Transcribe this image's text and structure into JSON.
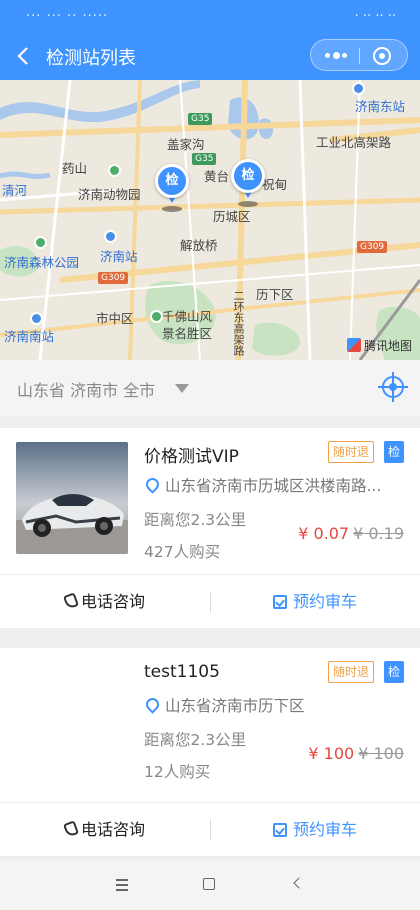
{
  "status_bar": {
    "left_text": "··· ··· ·· ·····",
    "right_text": "· ·· ·· ··"
  },
  "header": {
    "title": "检测站列表",
    "menu_icon": "more-dots-icon",
    "close_icon": "mini-program-close-icon"
  },
  "map": {
    "labels": [
      "济南东站",
      "盖家沟",
      "工业北高架路",
      "药山",
      "黄台",
      "祝甸",
      "济南动物园",
      "历城区",
      "清河",
      "解放桥",
      "济南站",
      "济南森林公园",
      "二环东高架路",
      "历下区",
      "市中区",
      "千佛山风景名胜区",
      "济南南站"
    ],
    "road_shields": [
      "G35",
      "G35",
      "G309",
      "G309"
    ],
    "brand": "腾讯地图",
    "markers": [
      "检",
      "检"
    ]
  },
  "filter": {
    "location": "山东省 济南市 全市"
  },
  "stations": [
    {
      "name": "价格测试VIP",
      "tag_refund": "随时退",
      "tag_check": "检",
      "address": "山东省济南市历城区洪楼南路...",
      "distance": "距离您2.3公里",
      "sold": "427人购买",
      "price": "¥ 0.07",
      "original_price": "¥ 0.19",
      "call_label": "电话咨询",
      "book_label": "预约审车",
      "has_image": true
    },
    {
      "name": "test1105",
      "tag_refund": "随时退",
      "tag_check": "检",
      "address": "山东省济南市历下区",
      "distance": "距离您2.3公里",
      "sold": "12人购买",
      "price": "¥ 100",
      "original_price": "¥ 100",
      "call_label": "电话咨询",
      "book_label": "预约审车",
      "has_image": false
    }
  ],
  "colors": {
    "primary": "#3f93ff",
    "price": "#e8473f",
    "refund_tag": "#f0a04b"
  }
}
